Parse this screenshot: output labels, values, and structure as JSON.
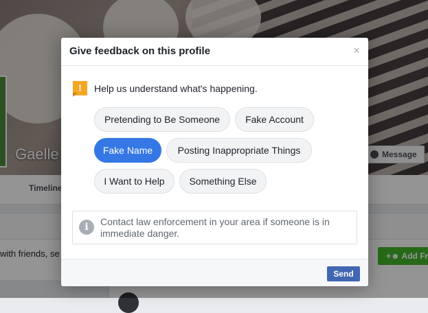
{
  "background": {
    "profile_name": "Gaelle",
    "message_label": "Message",
    "timeline_tab": "Timeline",
    "friends_text": "with friends, se",
    "add_friend_label": "Add Fri"
  },
  "dialog": {
    "title": "Give feedback on this profile",
    "close_glyph": "×",
    "intro_icon_glyph": "!",
    "intro_text": "Help us understand what's happening.",
    "options": [
      {
        "label": "Pretending to Be Someone",
        "selected": false
      },
      {
        "label": "Fake Account",
        "selected": false
      },
      {
        "label": "Fake Name",
        "selected": true
      },
      {
        "label": "Posting Inappropriate Things",
        "selected": false
      },
      {
        "label": "I Want to Help",
        "selected": false
      },
      {
        "label": "Something Else",
        "selected": false
      }
    ],
    "info_icon_glyph": "i",
    "notice_text": "Contact law enforcement in your area if someone is in immediate danger.",
    "send_label": "Send"
  },
  "colors": {
    "accent_selected": "#3578e5",
    "send_button": "#4267b2",
    "warning_flag": "#f5a623",
    "add_friend": "#42b72a"
  }
}
